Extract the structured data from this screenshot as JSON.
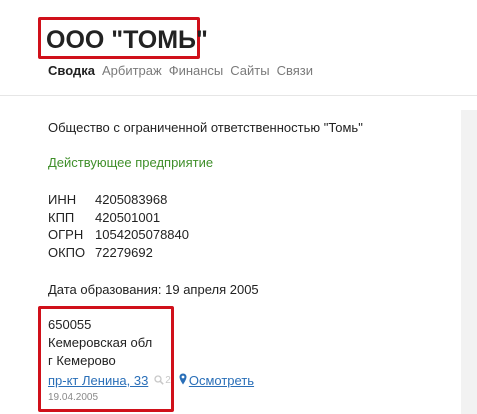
{
  "header": {
    "title": "ООО \"ТОМЬ\""
  },
  "tabs": [
    {
      "label": "Сводка",
      "active": true
    },
    {
      "label": "Арбитраж",
      "active": false
    },
    {
      "label": "Финансы",
      "active": false
    },
    {
      "label": "Сайты",
      "active": false
    },
    {
      "label": "Связи",
      "active": false
    }
  ],
  "summary": {
    "full_name": "Общество с ограниченной ответственностью \"Томь\"",
    "status": "Действующее предприятие",
    "codes": [
      {
        "key": "ИНН",
        "value": "4205083968"
      },
      {
        "key": "КПП",
        "value": "420501001"
      },
      {
        "key": "ОГРН",
        "value": "1054205078840"
      },
      {
        "key": "ОКПО",
        "value": "72279692"
      }
    ],
    "registration": "Дата образования: 19 апреля 2005"
  },
  "address": {
    "postal_code": "650055",
    "region": "Кемеровская обл",
    "city": "г Кемерово",
    "street_link": "пр-кт Ленина, 33",
    "search_count": "2",
    "view_label": "Осмотреть",
    "date": "19.04.2005"
  },
  "colors": {
    "highlight_border": "#d0101a",
    "status_green": "#3f8f2a",
    "link_blue": "#2a6fb8"
  }
}
